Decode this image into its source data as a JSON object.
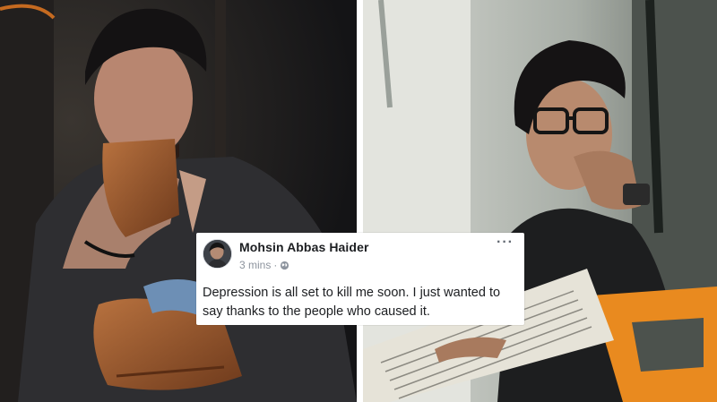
{
  "post": {
    "author": "Mohsin Abbas Haider",
    "time": "3 mins",
    "separator": "·",
    "privacy_icon": "globe-icon",
    "more_label": "···",
    "text": "Depression is all set to kill me soon. I just wanted to say thanks to the people who caused it."
  },
  "colors": {
    "card_background": "#ffffff",
    "author_text": "#1c1e21",
    "meta_text": "#8d949e",
    "glove": "#9b5a32",
    "bus_handle": "#e98a1f"
  }
}
